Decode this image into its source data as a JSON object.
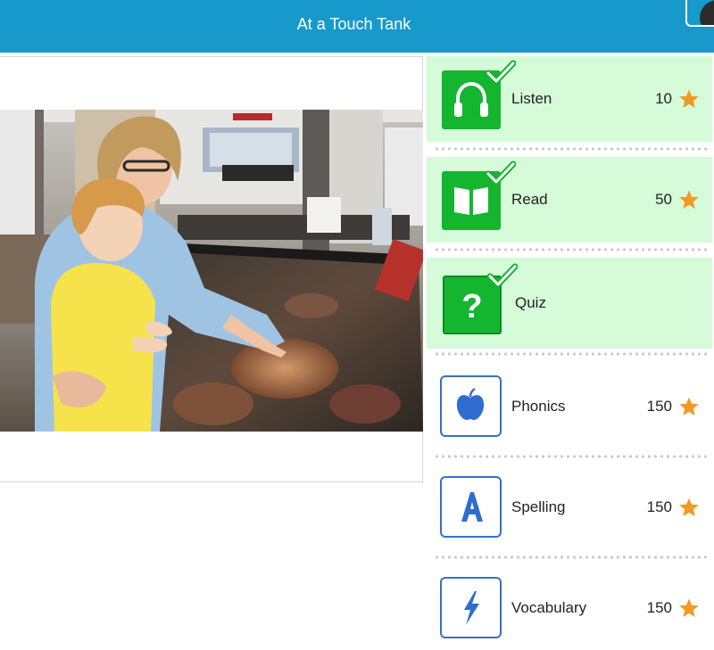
{
  "header": {
    "title": "At a Touch Tank"
  },
  "colors": {
    "header": "#1899cc",
    "done_bg": "#d5fbd8",
    "done_tile": "#14b52f",
    "outline_tile": "#3570c7",
    "star": "#f29a26"
  },
  "activities": [
    {
      "label": "Listen",
      "points": "10",
      "icon": "headphones-icon",
      "completed": true
    },
    {
      "label": "Read",
      "points": "50",
      "icon": "book-icon",
      "completed": true
    },
    {
      "label": "Quiz",
      "points": "",
      "icon": "question-icon",
      "completed": true
    },
    {
      "label": "Phonics",
      "points": "150",
      "icon": "apple-icon",
      "completed": false
    },
    {
      "label": "Spelling",
      "points": "150",
      "icon": "letter-a-icon",
      "completed": false
    },
    {
      "label": "Vocabulary",
      "points": "150",
      "icon": "lightning-icon",
      "completed": false
    }
  ]
}
